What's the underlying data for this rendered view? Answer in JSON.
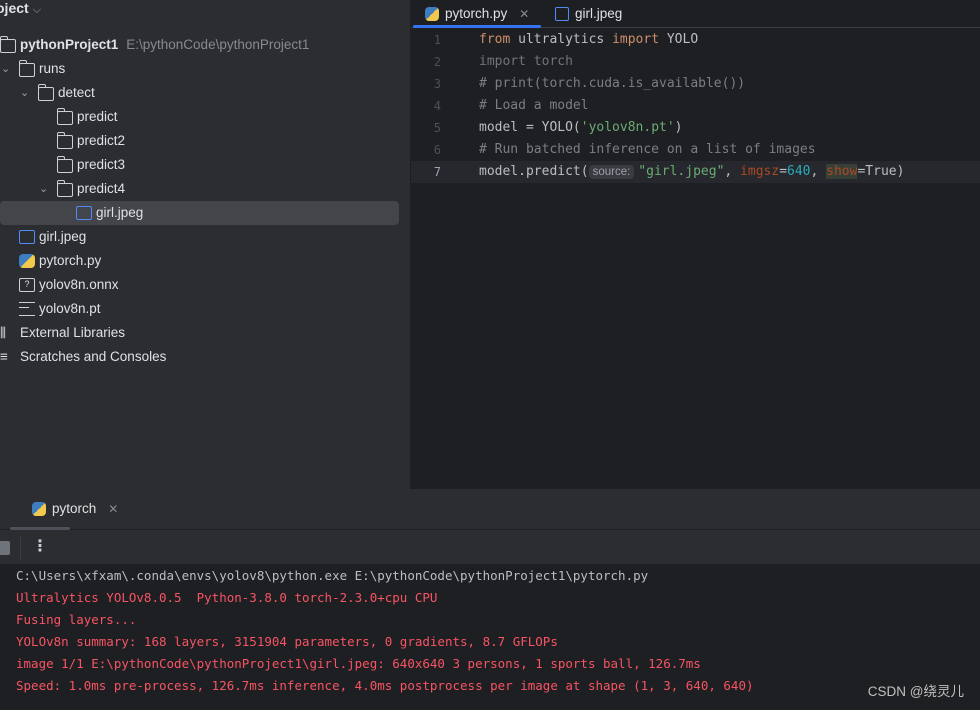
{
  "sidebar": {
    "title": "oject",
    "tree": [
      {
        "label": "pythonProject1",
        "path": "E:\\pythonCode\\pythonProject1",
        "icon": "folder-icon",
        "depth": 0,
        "bold": true
      },
      {
        "label": "runs",
        "icon": "folder-icon",
        "depth": 1,
        "expanded": true
      },
      {
        "label": "detect",
        "icon": "folder-icon",
        "depth": 2,
        "expanded": true
      },
      {
        "label": "predict",
        "icon": "folder-icon",
        "depth": 3
      },
      {
        "label": "predict2",
        "icon": "folder-icon",
        "depth": 3
      },
      {
        "label": "predict3",
        "icon": "folder-icon",
        "depth": 3
      },
      {
        "label": "predict4",
        "icon": "folder-icon",
        "depth": 3,
        "expanded": true
      },
      {
        "label": "girl.jpeg",
        "icon": "image-icon",
        "depth": 4,
        "selected": true
      },
      {
        "label": "girl.jpeg",
        "icon": "image-icon",
        "depth": 1
      },
      {
        "label": "pytorch.py",
        "icon": "python-icon",
        "depth": 1
      },
      {
        "label": "yolov8n.onnx",
        "icon": "unknown-file-icon",
        "depth": 1
      },
      {
        "label": "yolov8n.pt",
        "icon": "text-file-icon",
        "depth": 1
      },
      {
        "label": "External Libraries",
        "icon": "library-icon",
        "depth": 0
      },
      {
        "label": "Scratches and Consoles",
        "icon": "scratches-icon",
        "depth": 0
      }
    ]
  },
  "editor": {
    "tabs": [
      {
        "label": "pytorch.py",
        "active": true
      },
      {
        "label": "girl.jpeg",
        "active": false
      }
    ],
    "current_line": 7,
    "hint_label": "source:",
    "lines": [
      [
        {
          "t": "from ",
          "c": "#cf8e6d"
        },
        {
          "t": "ultralytics ",
          "c": "#bcbec4"
        },
        {
          "t": "import ",
          "c": "#cf8e6d"
        },
        {
          "t": "YOLO",
          "c": "#bcbec4"
        }
      ],
      [
        {
          "t": "import torch",
          "c": "#6f737a"
        }
      ],
      [
        {
          "t": "# print(torch.cuda.is_available())",
          "c": "#7a7e85"
        }
      ],
      [
        {
          "t": "# Load a model",
          "c": "#7a7e85"
        }
      ],
      [
        {
          "t": "model = YOLO(",
          "c": "#bcbec4"
        },
        {
          "t": "'yolov8n.pt'",
          "c": "#6aab73"
        },
        {
          "t": ")",
          "c": "#bcbec4"
        }
      ],
      [
        {
          "t": "# Run batched inference on a list of images",
          "c": "#7a7e85"
        }
      ],
      [
        {
          "t": "model.predict(",
          "c": "#bcbec4"
        },
        {
          "t": "HINT"
        },
        {
          "t": "\"girl.jpeg\"",
          "c": "#6aab73"
        },
        {
          "t": ", ",
          "c": "#bcbec4"
        },
        {
          "t": "imgsz",
          "c": "#aa4926"
        },
        {
          "t": "=",
          "c": "#bcbec4"
        },
        {
          "t": "640",
          "c": "#2aacb8"
        },
        {
          "t": ", ",
          "c": "#bcbec4"
        },
        {
          "t": "show",
          "c": "#aa4926",
          "bg": "#374037"
        },
        {
          "t": "=True)",
          "c": "#bcbec4"
        }
      ]
    ]
  },
  "run_panel": {
    "tab_label": "pytorch",
    "console": [
      {
        "text": "C:\\Users\\xfxam\\.conda\\envs\\yolov8\\python.exe E:\\pythonCode\\pythonProject1\\pytorch.py",
        "color": "#bcbec4"
      },
      {
        "text": "Ultralytics YOLOv8.0.5  Python-3.8.0 torch-2.3.0+cpu CPU",
        "color": "#f75464"
      },
      {
        "text": "Fusing layers...",
        "color": "#f75464"
      },
      {
        "text": "YOLOv8n summary: 168 layers, 3151904 parameters, 0 gradients, 8.7 GFLOPs",
        "color": "#f75464"
      },
      {
        "text": "image 1/1 E:\\pythonCode\\pythonProject1\\girl.jpeg: 640x640 3 persons, 1 sports ball, 126.7ms",
        "color": "#f75464"
      },
      {
        "text": "Speed: 1.0ms pre-process, 126.7ms inference, 4.0ms postprocess per image at shape (1, 3, 640, 640)",
        "color": "#f75464"
      }
    ]
  },
  "watermark": "CSDN @绕灵儿"
}
